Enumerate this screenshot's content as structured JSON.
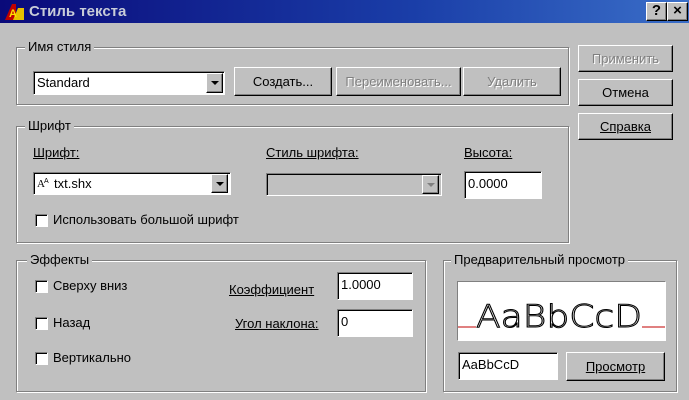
{
  "window": {
    "title": "Стиль текста",
    "help_button": "?",
    "close_button": "×"
  },
  "style_name": {
    "legend": "Имя стиля",
    "selected": "Standard",
    "create_label": "Создать...",
    "rename_label": "Переименовать...",
    "delete_label": "Удалить"
  },
  "side_buttons": {
    "apply_label": "Применить",
    "cancel_label": "Отмена",
    "help_label": "Справка"
  },
  "font": {
    "legend": "Шрифт",
    "font_label": "Шрифт:",
    "font_value": "txt.shx",
    "font_style_label": "Стиль шрифта:",
    "font_style_value": "",
    "height_label": "Высота:",
    "height_value": "0.0000",
    "bigfont_label": "Использовать большой шрифт",
    "bigfont_checked": false
  },
  "effects": {
    "legend": "Эффекты",
    "upside_down_label": "Сверху вниз",
    "backwards_label": "Назад",
    "vertical_label": "Вертикально",
    "width_factor_label": "Коэффициент",
    "width_factor_value": "1.0000",
    "oblique_label": "Угол наклона:",
    "oblique_value": "0"
  },
  "preview": {
    "legend": "Предварительный просмотр",
    "sample_text": "AaBbCcD",
    "input_value": "AaBbCcD",
    "preview_button": "Просмотр"
  },
  "colors": {
    "title_start": "#0a0a7a",
    "title_end": "#3a6ec8",
    "face": "#c0c0c0",
    "preview_baseline": "#c00000"
  }
}
